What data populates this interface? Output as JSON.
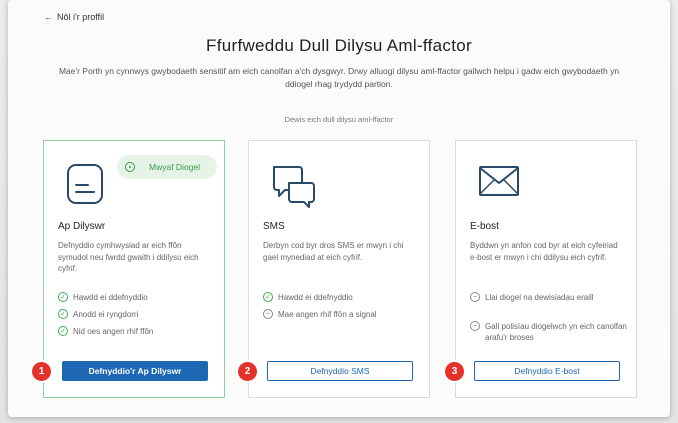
{
  "nav": {
    "back_label": "Nôl i'r proffil"
  },
  "header": {
    "title": "Ffurfweddu Dull Dilysu Aml-ffactor",
    "description": "Mae'r Porth yn cynnwys gwybodaeth sensitif am eich canolfan a'ch dysgwyr. Drwy alluogi dilysu aml-ffactor gallwch helpu i gadw eich gwybodaeth yn ddiogel rhag trydydd partion.",
    "prompt": "Dewis eich dull dilysu aml-ffactor"
  },
  "cards": [
    {
      "name": "Ap Dilyswr",
      "badge": "Mwyaf Diogel",
      "description": "Defnyddio cymhwysiad ar eich ffôn symudol neu fwrdd gwaith i ddilysu eich cyfrif.",
      "features": [
        {
          "text": "Hawdd ei ddefnyddio",
          "kind": "positive"
        },
        {
          "text": "Anodd ei ryngdorri",
          "kind": "positive"
        },
        {
          "text": "Nid oes angen rhif ffôn",
          "kind": "positive"
        }
      ],
      "button": "Defnyddio'r Ap Dilyswr",
      "step": "1"
    },
    {
      "name": "SMS",
      "description": "Derbyn cod byr dros SMS er mwyn i chi gael mynediad at eich cyfrif.",
      "features": [
        {
          "text": "Hawdd ei ddefnyddio",
          "kind": "positive"
        },
        {
          "text": "Mae angen rhif ffôn a signal",
          "kind": "neutral"
        }
      ],
      "button": "Defnyddio SMS",
      "step": "2"
    },
    {
      "name": "E-bost",
      "description": "Byddwn yn anfon cod byr at eich cyfeiriad e-bost er mwyn i chi ddilysu eich cyfrif.",
      "features": [
        {
          "text": "Llai diogel na dewisiadau eraill",
          "kind": "neutral"
        },
        {
          "text": "Gall polisïau diogelwch yn eich canolfan arafu'r broses",
          "kind": "neutral"
        }
      ],
      "button": "Defnyddio E-bost",
      "step": "3"
    }
  ],
  "colors": {
    "primary": "#1d67b4",
    "positive": "#3bae4e",
    "step_marker": "#e4322b",
    "selected_border": "#8fd29a"
  }
}
